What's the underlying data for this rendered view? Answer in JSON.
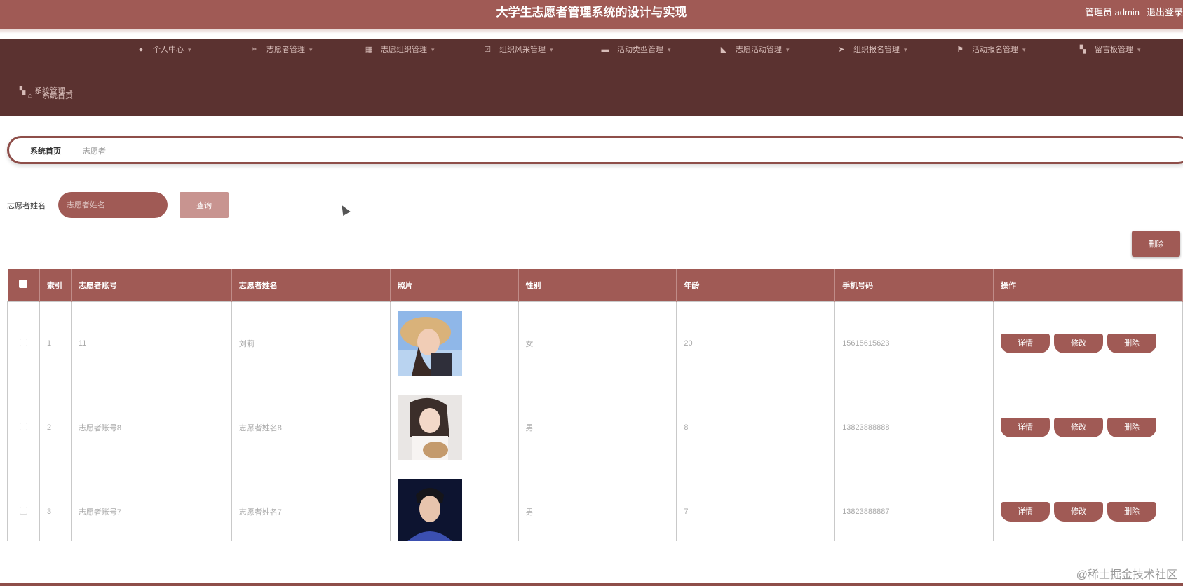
{
  "header": {
    "title": "大学生志愿者管理系统的设计与实现",
    "user_label": "管理员 admin",
    "logout_label": "退出登录"
  },
  "nav": {
    "items": [
      {
        "label": "系统首页",
        "icon": "home-icon"
      },
      {
        "label": "个人中心",
        "icon": "user-icon"
      },
      {
        "label": "志愿者管理",
        "icon": "scissors-icon"
      },
      {
        "label": "志愿组织管理",
        "icon": "calendar-icon"
      },
      {
        "label": "组织风采管理",
        "icon": "checkbox-icon"
      },
      {
        "label": "活动类型管理",
        "icon": "message-icon"
      },
      {
        "label": "志愿活动管理",
        "icon": "thumbs-up-icon"
      },
      {
        "label": "组织报名管理",
        "icon": "send-icon"
      },
      {
        "label": "活动报名管理",
        "icon": "flag-icon"
      },
      {
        "label": "留言板管理",
        "icon": "grid-icon"
      },
      {
        "label": "系统管理",
        "icon": "grid-icon"
      }
    ]
  },
  "breadcrumb": {
    "home": "系统首页",
    "separator": "|",
    "current": "志愿者"
  },
  "search": {
    "label": "志愿者姓名",
    "placeholder": "志愿者姓名",
    "query_label": "查询"
  },
  "toolbar": {
    "delete_label": "删除"
  },
  "table": {
    "columns": [
      "索引",
      "志愿者账号",
      "志愿者姓名",
      "照片",
      "性别",
      "年龄",
      "手机号码",
      "操作"
    ],
    "rows": [
      {
        "index": "1",
        "account": "11",
        "name": "刘莉",
        "gender": "女",
        "age": "20",
        "phone": "15615615623"
      },
      {
        "index": "2",
        "account": "志愿者账号8",
        "name": "志愿者姓名8",
        "gender": "男",
        "age": "8",
        "phone": "13823888888"
      },
      {
        "index": "3",
        "account": "志愿者账号7",
        "name": "志愿者姓名7",
        "gender": "男",
        "age": "7",
        "phone": "13823888887"
      }
    ],
    "actions": {
      "detail": "详情",
      "edit": "修改",
      "delete": "删除"
    }
  },
  "watermark": "@稀土掘金技术社区",
  "colors": {
    "primary": "#a05a55",
    "nav_bg": "#5b3230",
    "light_button": "#c89490"
  }
}
